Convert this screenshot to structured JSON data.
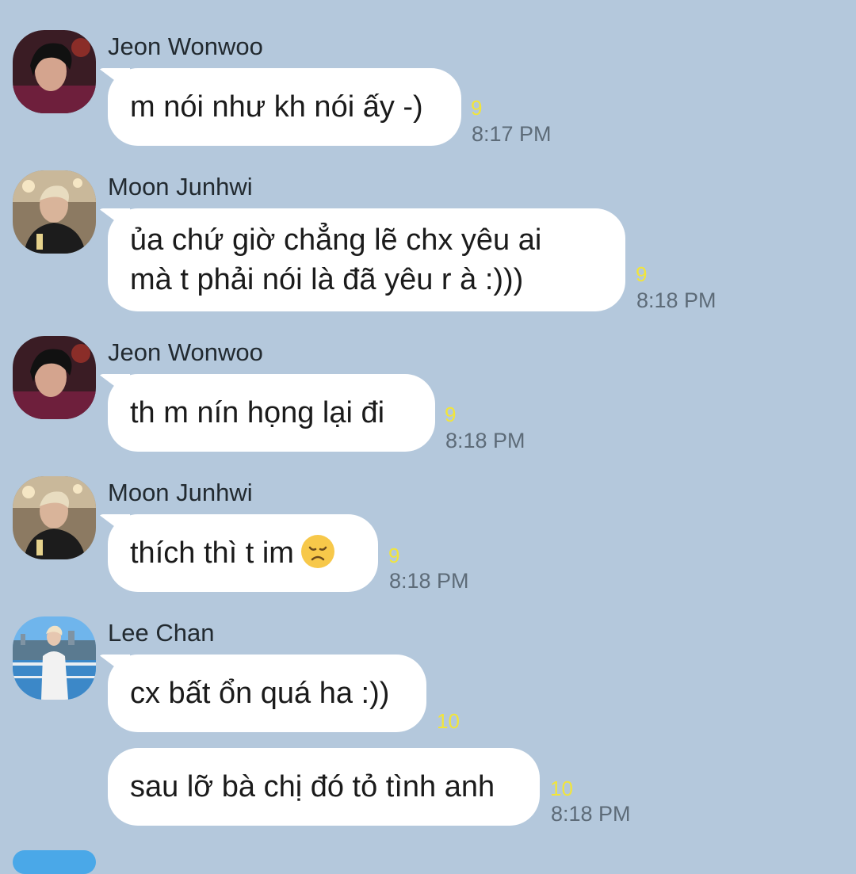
{
  "messages": [
    {
      "sender": "Jeon Wonwoo",
      "text": "m nói như kh nói ấy -)",
      "count": "9",
      "time": "8:17 PM"
    },
    {
      "sender": "Moon Junhwi",
      "text": "ủa chứ giờ chẳng lẽ chx yêu ai\nmà t phải nói là đã yêu r à :)))",
      "count": "9",
      "time": "8:18 PM"
    },
    {
      "sender": "Jeon Wonwoo",
      "text": "th m nín họng lại đi",
      "count": "9",
      "time": "8:18 PM"
    },
    {
      "sender": "Moon Junhwi",
      "text": "thích thì t im",
      "emoji": "disappointed-face-icon",
      "count": "9",
      "time": "8:18 PM"
    },
    {
      "sender": "Lee Chan",
      "text": "cx bất ổn quá ha :))",
      "count": "10",
      "time": ""
    },
    {
      "sender": "",
      "text": "sau lỡ bà chị đó tỏ tình anh",
      "count": "10",
      "time": "8:18 PM"
    }
  ],
  "colors": {
    "background": "#b4c8dc",
    "bubble": "#ffffff",
    "unread_count": "#f2e53a",
    "time": "#5d6b78"
  }
}
